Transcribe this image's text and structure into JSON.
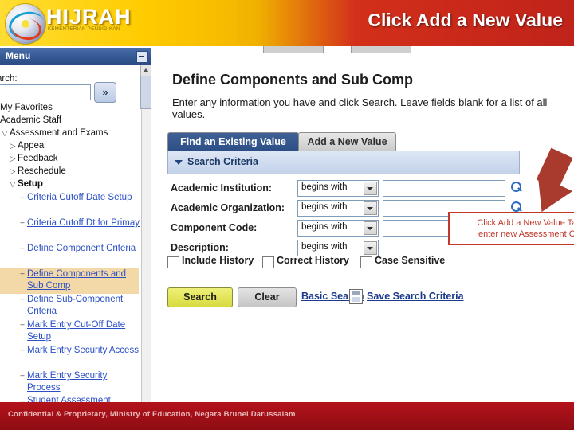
{
  "slide": {
    "logo_word": "HIJRAH",
    "logo_sub": "KEMENTERIAN PENDIDIKAN",
    "title": "Click Add a New Value",
    "footer": "Confidential & Proprietary, Ministry of Education, Negara Brunei Darussalam"
  },
  "menu": {
    "title": "Menu",
    "collapse_icon": "minimize-icon",
    "search_label": "arch:",
    "search_value": "",
    "go_icon": "double-chevron-right-icon",
    "items": [
      {
        "label": "My Favorites",
        "type": "root",
        "twisty": "",
        "indent": 0
      },
      {
        "label": "Academic Staff",
        "type": "root",
        "twisty": "",
        "indent": 0
      },
      {
        "label": "Assessment and Exams",
        "type": "expanded",
        "twisty": "▽",
        "indent": 0
      },
      {
        "label": "Appeal",
        "type": "collapsed",
        "twisty": "▷",
        "indent": 1
      },
      {
        "label": "Feedback",
        "type": "collapsed",
        "twisty": "▷",
        "indent": 1
      },
      {
        "label": "Reschedule",
        "type": "collapsed",
        "twisty": "▷",
        "indent": 1
      },
      {
        "label": "Setup",
        "type": "expanded",
        "twisty": "▽",
        "indent": 1
      },
      {
        "label": "Criteria Cutoff Date Setup",
        "type": "leaf",
        "twisty": "–",
        "indent": 2
      },
      {
        "label": "Criteria Cutoff Dt for Primay",
        "type": "leaf",
        "twisty": "–",
        "indent": 2
      },
      {
        "label": "Define Component Criteria",
        "type": "leaf",
        "twisty": "–",
        "indent": 2
      },
      {
        "label": "Define Components and Sub Comp",
        "type": "leaf-selected",
        "twisty": "–",
        "indent": 2
      },
      {
        "label": "Define Sub-Component Criteria",
        "type": "leaf",
        "twisty": "–",
        "indent": 2
      },
      {
        "label": "Mark Entry Cut-Off Date Setup",
        "type": "leaf",
        "twisty": "–",
        "indent": 2
      },
      {
        "label": "Mark Entry Security Access",
        "type": "leaf",
        "twisty": "–",
        "indent": 2
      },
      {
        "label": "Mark Entry Security Process",
        "type": "leaf",
        "twisty": "–",
        "indent": 2
      },
      {
        "label": "Student Assessment",
        "type": "leaf",
        "twisty": "–",
        "indent": 2
      }
    ]
  },
  "page": {
    "title": "Define Components and Sub Comp",
    "instruction": "Enter any information you have and click Search. Leave fields blank for a list of all values.",
    "tabs": [
      {
        "label": "Find an Existing Value",
        "active": true
      },
      {
        "label": "Add a New Value",
        "active": false
      }
    ],
    "section_title": "Search Criteria",
    "fields": [
      {
        "label": "Academic Institution:",
        "operator": "begins with",
        "value": "",
        "lookup": true
      },
      {
        "label": "Academic Organization:",
        "operator": "begins with",
        "value": "",
        "lookup": true
      },
      {
        "label": "Component Code:",
        "operator": "begins with",
        "value": "",
        "lookup": false
      },
      {
        "label": "Description:",
        "operator": "begins with",
        "value": "",
        "lookup": false
      }
    ],
    "checkboxes": [
      {
        "label": "Include History",
        "checked": false
      },
      {
        "label": "Correct History",
        "checked": false
      },
      {
        "label": "Case Sensitive",
        "checked": false
      }
    ],
    "buttons": {
      "search": "Search",
      "clear": "Clear",
      "basic_search": "Basic Search",
      "save_search": "Save Search Criteria",
      "save_icon": "save-document-icon"
    }
  },
  "callout": {
    "line1": "Click Add a New Value Tab to",
    "line2": "enter new Assessment Code",
    "border_color": "#c0392b",
    "arrow_color": "#a83a2e"
  }
}
